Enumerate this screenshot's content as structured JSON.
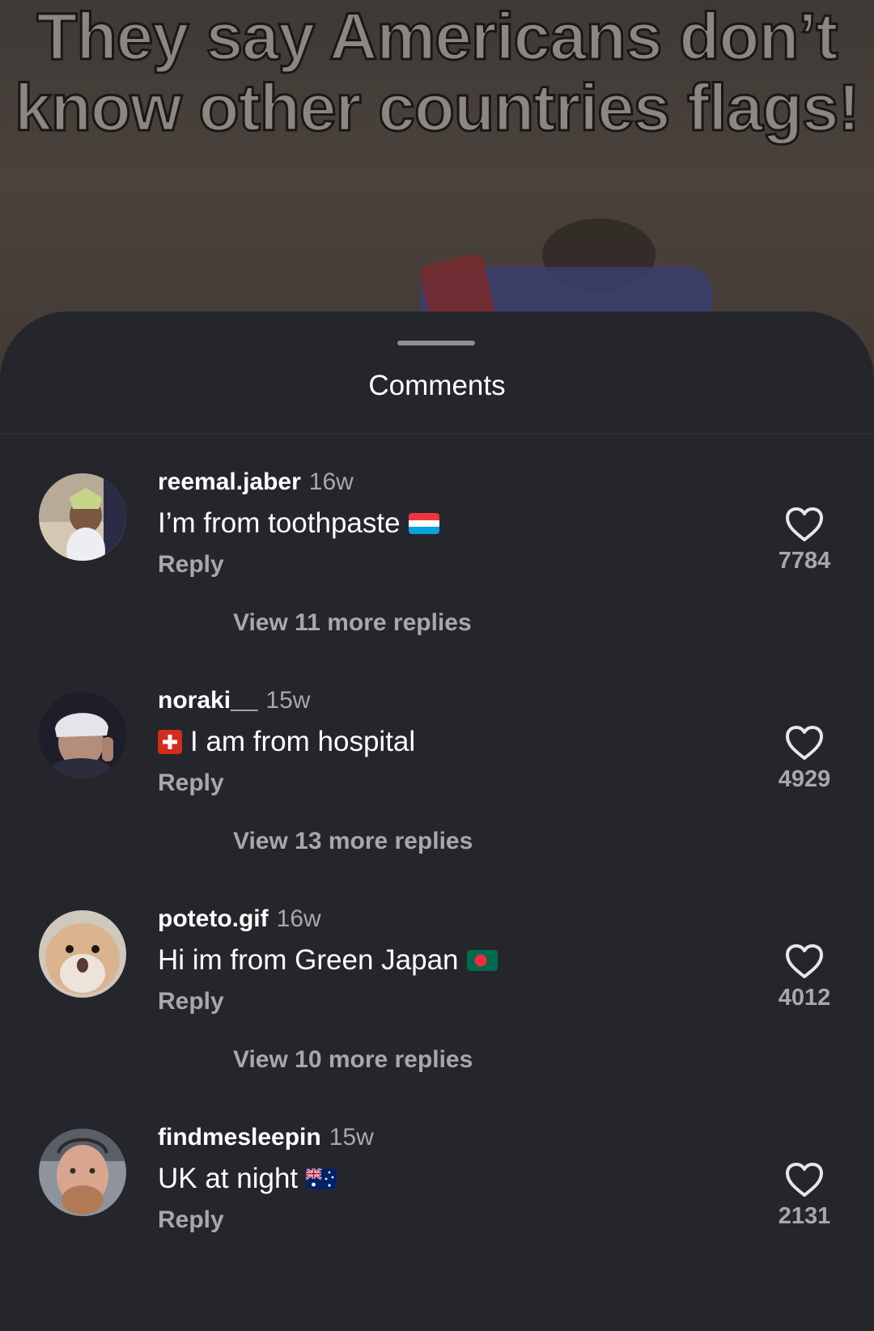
{
  "video": {
    "caption_line1": "They say Americans don’t",
    "caption_line2": "know other countries flags!"
  },
  "sheet": {
    "title": "Comments"
  },
  "comments": [
    {
      "username": "reemal.jaber",
      "age": "16w",
      "text": "I’m from toothpaste",
      "flag": "luxembourg-flag",
      "reply_label": "Reply",
      "likes": "7784",
      "view_replies": "View 11 more replies"
    },
    {
      "username": "noraki__",
      "age": "15w",
      "text": "I am from hospital",
      "flag": "switzerland-flag",
      "reply_label": "Reply",
      "likes": "4929",
      "view_replies": "View 13 more replies"
    },
    {
      "username": "poteto.gif",
      "age": "16w",
      "text": "Hi im from Green Japan",
      "flag": "bangladesh-flag",
      "reply_label": "Reply",
      "likes": "4012",
      "view_replies": "View 10 more replies"
    },
    {
      "username": "findmesleepin",
      "age": "15w",
      "text": "UK at night",
      "flag": "australia-flag",
      "reply_label": "Reply",
      "likes": "2131"
    }
  ],
  "icons": {
    "like": "heart-outline-icon"
  },
  "colors": {
    "sheet_background": "#25262b",
    "primary_text": "#ffffff",
    "secondary_text": "#a7a8ad"
  }
}
